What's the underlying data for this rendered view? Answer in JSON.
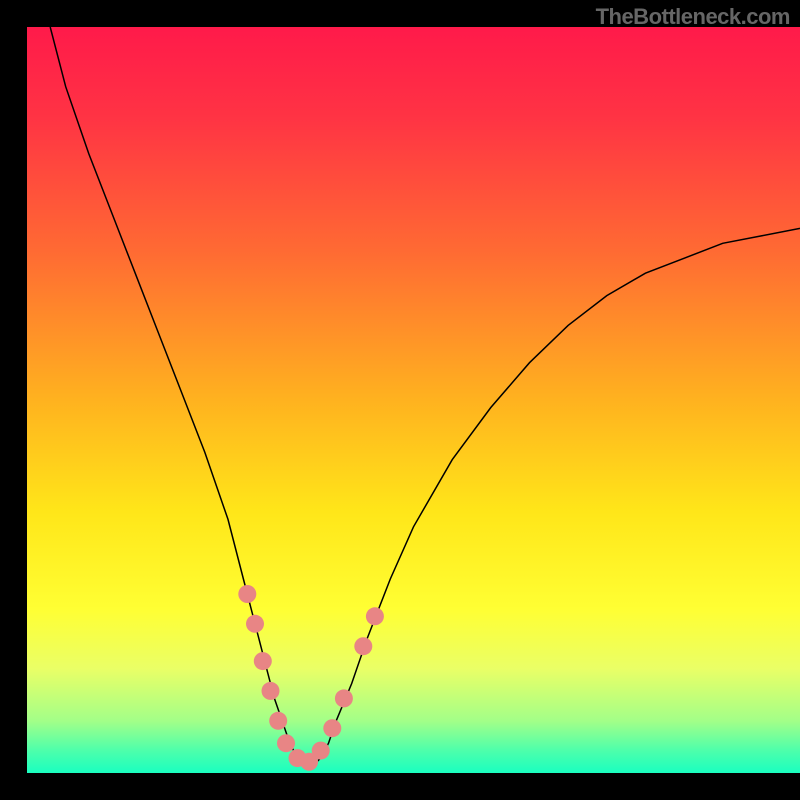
{
  "watermark": "TheBottleneck.com",
  "chart_data": {
    "type": "line",
    "title": "",
    "xlabel": "",
    "ylabel": "",
    "xlim": [
      0,
      100
    ],
    "ylim": [
      0,
      100
    ],
    "background": {
      "type": "vertical-gradient",
      "stops": [
        {
          "pos": 0.0,
          "color": "#ff1a4a"
        },
        {
          "pos": 0.12,
          "color": "#ff3344"
        },
        {
          "pos": 0.3,
          "color": "#ff6a33"
        },
        {
          "pos": 0.5,
          "color": "#ffb21f"
        },
        {
          "pos": 0.65,
          "color": "#ffe619"
        },
        {
          "pos": 0.78,
          "color": "#ffff33"
        },
        {
          "pos": 0.86,
          "color": "#eaff66"
        },
        {
          "pos": 0.93,
          "color": "#a3ff88"
        },
        {
          "pos": 0.97,
          "color": "#4dffab"
        },
        {
          "pos": 1.0,
          "color": "#1affc0"
        }
      ]
    },
    "series": [
      {
        "name": "bottleneck-curve",
        "stroke": "#000000",
        "stroke_width": 1.5,
        "x": [
          3,
          5,
          8,
          11,
          14,
          17,
          20,
          23,
          26,
          28,
          30,
          31,
          32,
          33,
          34,
          35,
          36,
          37,
          38,
          39,
          40,
          42,
          44,
          47,
          50,
          55,
          60,
          65,
          70,
          75,
          80,
          85,
          90,
          95,
          100
        ],
        "y": [
          100,
          92,
          83,
          75,
          67,
          59,
          51,
          43,
          34,
          26,
          18,
          14,
          10,
          7,
          4,
          2,
          1,
          1,
          2,
          4,
          7,
          12,
          18,
          26,
          33,
          42,
          49,
          55,
          60,
          64,
          67,
          69,
          71,
          72,
          73
        ]
      }
    ],
    "markers": {
      "name": "highlighted-points",
      "color": "#e88585",
      "radius": 9,
      "points": [
        {
          "x": 28.5,
          "y": 24
        },
        {
          "x": 29.5,
          "y": 20
        },
        {
          "x": 30.5,
          "y": 15
        },
        {
          "x": 31.5,
          "y": 11
        },
        {
          "x": 32.5,
          "y": 7
        },
        {
          "x": 33.5,
          "y": 4
        },
        {
          "x": 35.0,
          "y": 2
        },
        {
          "x": 36.5,
          "y": 1.5
        },
        {
          "x": 38.0,
          "y": 3
        },
        {
          "x": 39.5,
          "y": 6
        },
        {
          "x": 41.0,
          "y": 10
        },
        {
          "x": 43.5,
          "y": 17
        },
        {
          "x": 45.0,
          "y": 21
        }
      ]
    }
  }
}
